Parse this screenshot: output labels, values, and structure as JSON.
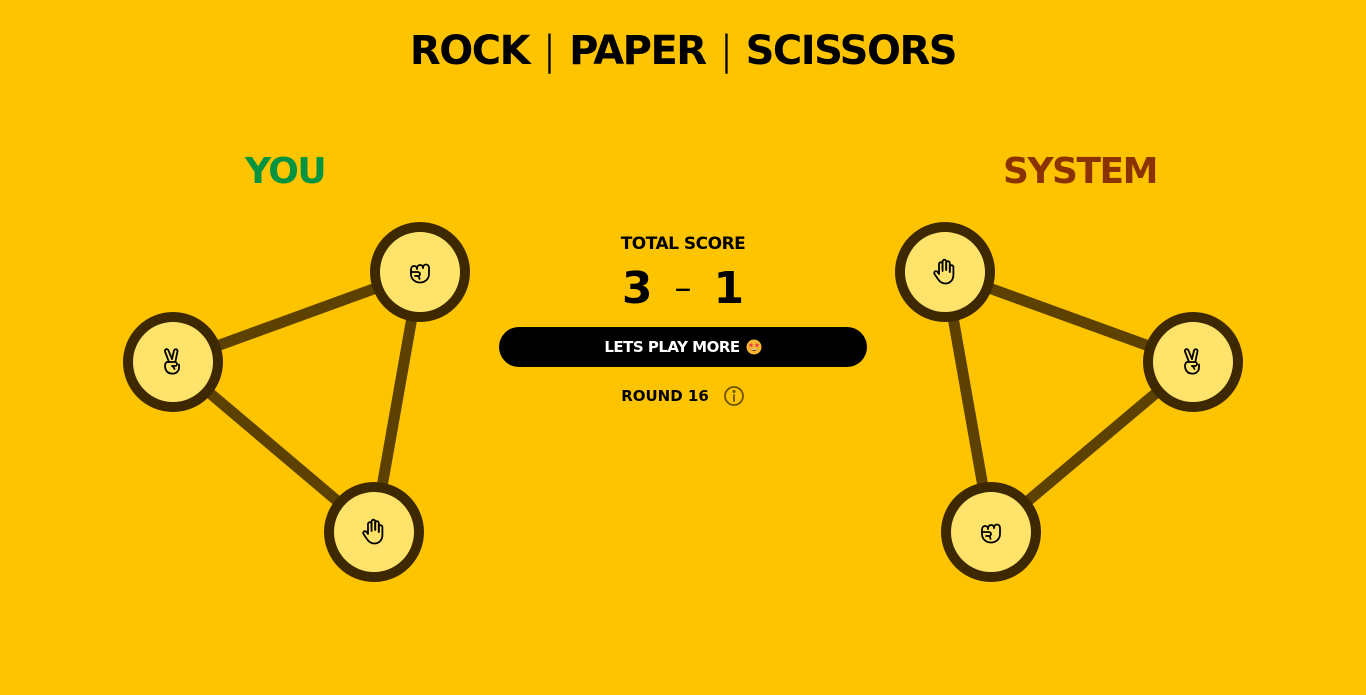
{
  "title": {
    "part1": "ROCK",
    "part2": "PAPER",
    "part3": "SCISSORS",
    "separator": "|"
  },
  "players": {
    "you": {
      "label": "YOU",
      "color": "#009440"
    },
    "system": {
      "label": "SYSTEM",
      "color": "#8A3300"
    }
  },
  "score": {
    "title": "TOTAL SCORE",
    "you": "3",
    "dash": "–",
    "system": "1"
  },
  "actions": {
    "play_more_label": "LETS PLAY MORE"
  },
  "round": {
    "label": "ROUND 16"
  },
  "colors": {
    "background": "#FFC400",
    "ring": "#3E2800",
    "connector": "#5C4100",
    "hand_fill": "#FFE36A"
  },
  "icons": {
    "you_hands": [
      "scissors-icon",
      "rock-icon",
      "paper-icon"
    ],
    "system_hands": [
      "paper-icon",
      "scissors-icon",
      "rock-icon"
    ],
    "button_emoji": "star-struck-emoji-icon",
    "round_info": "info-icon"
  }
}
